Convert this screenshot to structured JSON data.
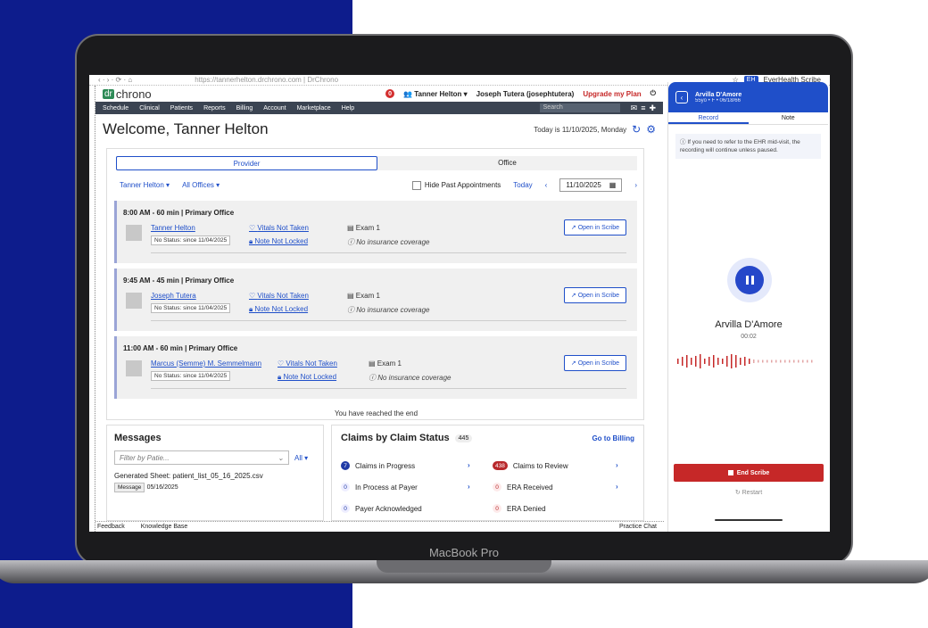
{
  "device": {
    "label": "MacBook Pro"
  },
  "browser": {
    "url": "https://tannerhelton.drchrono.com | DrChrono",
    "ext_badge": "EH",
    "ext_name": "EverHealth Scribe"
  },
  "header": {
    "logo_dr": "dr",
    "logo_text": "chrono",
    "notif_count": "0",
    "user": "Tanner Helton",
    "account": "Joseph Tutera (josephtutera)",
    "upgrade": "Upgrade my Plan"
  },
  "nav": {
    "items": [
      "Schedule",
      "Clinical",
      "Patients",
      "Reports",
      "Billing",
      "Account",
      "Marketplace",
      "Help"
    ],
    "search_placeholder": "Search"
  },
  "welcome": {
    "title": "Welcome, Tanner Helton",
    "today": "Today is 11/10/2025, Monday"
  },
  "schedule": {
    "tabs": [
      "Provider",
      "Office"
    ],
    "provider_filter": "Tanner Helton",
    "office_filter": "All Offices",
    "hide_past": "Hide Past Appointments",
    "today": "Today",
    "date": "11/10/2025",
    "open_label": "Open in Scribe",
    "appointments": [
      {
        "time": "8:00 AM - 60 min  |  Primary Office",
        "patient": "Tanner Helton",
        "status": "No Status: since 11/04/2025",
        "vitals": "Vitals Not Taken",
        "note": "Note Not Locked",
        "exam": "Exam 1",
        "insurance": "No insurance coverage"
      },
      {
        "time": "9:45 AM - 45 min  |  Primary Office",
        "patient": "Joseph Tutera",
        "status": "No Status: since 11/04/2025",
        "vitals": "Vitals Not Taken",
        "note": "Note Not Locked",
        "exam": "Exam 1",
        "insurance": "No insurance coverage"
      },
      {
        "time": "11:00 AM - 60 min  |  Primary Office",
        "patient": "Marcus (Semme) M. Semmelmann",
        "status": "No Status: since 11/04/2025",
        "vitals": "Vitals Not Taken",
        "note": "Note Not Locked",
        "exam": "Exam 1",
        "insurance": "No insurance coverage"
      }
    ],
    "end_text": "You have reached the end"
  },
  "messages": {
    "title": "Messages",
    "filter_placeholder": "Filter by Patie...",
    "all": "All",
    "item_title": "Generated Sheet: patient_list_05_16_2025.csv",
    "item_tag": "Message",
    "item_date": "05/16/2025"
  },
  "claims": {
    "title": "Claims by Claim Status",
    "count": "445",
    "goto": "Go to Billing",
    "rows": [
      {
        "count": "7",
        "label": "Claims in Progress"
      },
      {
        "count": "438",
        "label": "Claims to Review"
      },
      {
        "count": "0",
        "label": "In Process at Payer"
      },
      {
        "count": "0",
        "label": "ERA Received"
      },
      {
        "count": "0",
        "label": "Payer Acknowledged"
      },
      {
        "count": "0",
        "label": "ERA Denied"
      }
    ]
  },
  "footer": {
    "feedback": "Feedback",
    "kb": "Knowledge Base",
    "chat": "Practice Chat"
  },
  "scribe": {
    "patient": "Arvilla D'Amore",
    "sub": "55yo  •  F  •  06/18/66",
    "tab_record": "Record",
    "tab_note": "Note",
    "info": "If you need to refer to the EHR mid-visit, the recording will continue unless paused.",
    "patient_name": "Arvilla D'Amore",
    "elapsed": "00:02",
    "end": "End Scribe",
    "restart": "Restart"
  },
  "colors": {
    "accent": "#1f4fc9",
    "danger": "#c62828",
    "nav_bg": "#3b4452",
    "bg_blue": "#0d1c8c"
  }
}
